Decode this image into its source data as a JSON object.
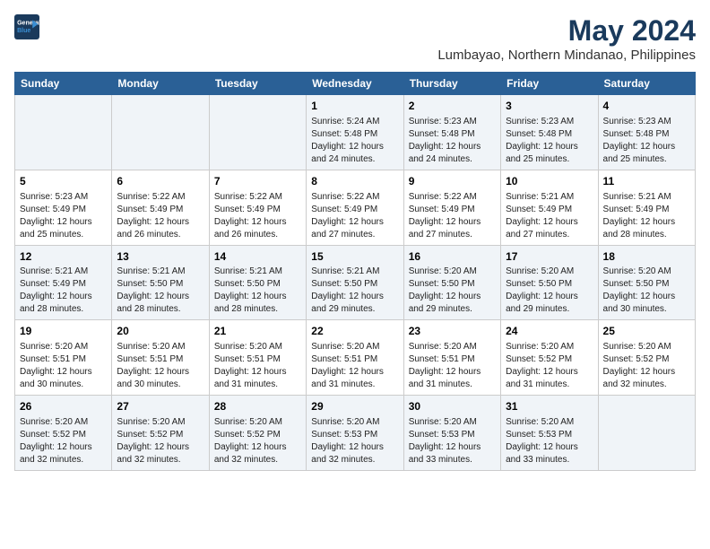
{
  "logo": {
    "line1": "General",
    "line2": "Blue"
  },
  "title": "May 2024",
  "subtitle": "Lumbayao, Northern Mindanao, Philippines",
  "weekdays": [
    "Sunday",
    "Monday",
    "Tuesday",
    "Wednesday",
    "Thursday",
    "Friday",
    "Saturday"
  ],
  "weeks": [
    [
      {
        "day": "",
        "info": ""
      },
      {
        "day": "",
        "info": ""
      },
      {
        "day": "",
        "info": ""
      },
      {
        "day": "1",
        "info": "Sunrise: 5:24 AM\nSunset: 5:48 PM\nDaylight: 12 hours\nand 24 minutes."
      },
      {
        "day": "2",
        "info": "Sunrise: 5:23 AM\nSunset: 5:48 PM\nDaylight: 12 hours\nand 24 minutes."
      },
      {
        "day": "3",
        "info": "Sunrise: 5:23 AM\nSunset: 5:48 PM\nDaylight: 12 hours\nand 25 minutes."
      },
      {
        "day": "4",
        "info": "Sunrise: 5:23 AM\nSunset: 5:48 PM\nDaylight: 12 hours\nand 25 minutes."
      }
    ],
    [
      {
        "day": "5",
        "info": "Sunrise: 5:23 AM\nSunset: 5:49 PM\nDaylight: 12 hours\nand 25 minutes."
      },
      {
        "day": "6",
        "info": "Sunrise: 5:22 AM\nSunset: 5:49 PM\nDaylight: 12 hours\nand 26 minutes."
      },
      {
        "day": "7",
        "info": "Sunrise: 5:22 AM\nSunset: 5:49 PM\nDaylight: 12 hours\nand 26 minutes."
      },
      {
        "day": "8",
        "info": "Sunrise: 5:22 AM\nSunset: 5:49 PM\nDaylight: 12 hours\nand 27 minutes."
      },
      {
        "day": "9",
        "info": "Sunrise: 5:22 AM\nSunset: 5:49 PM\nDaylight: 12 hours\nand 27 minutes."
      },
      {
        "day": "10",
        "info": "Sunrise: 5:21 AM\nSunset: 5:49 PM\nDaylight: 12 hours\nand 27 minutes."
      },
      {
        "day": "11",
        "info": "Sunrise: 5:21 AM\nSunset: 5:49 PM\nDaylight: 12 hours\nand 28 minutes."
      }
    ],
    [
      {
        "day": "12",
        "info": "Sunrise: 5:21 AM\nSunset: 5:49 PM\nDaylight: 12 hours\nand 28 minutes."
      },
      {
        "day": "13",
        "info": "Sunrise: 5:21 AM\nSunset: 5:50 PM\nDaylight: 12 hours\nand 28 minutes."
      },
      {
        "day": "14",
        "info": "Sunrise: 5:21 AM\nSunset: 5:50 PM\nDaylight: 12 hours\nand 28 minutes."
      },
      {
        "day": "15",
        "info": "Sunrise: 5:21 AM\nSunset: 5:50 PM\nDaylight: 12 hours\nand 29 minutes."
      },
      {
        "day": "16",
        "info": "Sunrise: 5:20 AM\nSunset: 5:50 PM\nDaylight: 12 hours\nand 29 minutes."
      },
      {
        "day": "17",
        "info": "Sunrise: 5:20 AM\nSunset: 5:50 PM\nDaylight: 12 hours\nand 29 minutes."
      },
      {
        "day": "18",
        "info": "Sunrise: 5:20 AM\nSunset: 5:50 PM\nDaylight: 12 hours\nand 30 minutes."
      }
    ],
    [
      {
        "day": "19",
        "info": "Sunrise: 5:20 AM\nSunset: 5:51 PM\nDaylight: 12 hours\nand 30 minutes."
      },
      {
        "day": "20",
        "info": "Sunrise: 5:20 AM\nSunset: 5:51 PM\nDaylight: 12 hours\nand 30 minutes."
      },
      {
        "day": "21",
        "info": "Sunrise: 5:20 AM\nSunset: 5:51 PM\nDaylight: 12 hours\nand 31 minutes."
      },
      {
        "day": "22",
        "info": "Sunrise: 5:20 AM\nSunset: 5:51 PM\nDaylight: 12 hours\nand 31 minutes."
      },
      {
        "day": "23",
        "info": "Sunrise: 5:20 AM\nSunset: 5:51 PM\nDaylight: 12 hours\nand 31 minutes."
      },
      {
        "day": "24",
        "info": "Sunrise: 5:20 AM\nSunset: 5:52 PM\nDaylight: 12 hours\nand 31 minutes."
      },
      {
        "day": "25",
        "info": "Sunrise: 5:20 AM\nSunset: 5:52 PM\nDaylight: 12 hours\nand 32 minutes."
      }
    ],
    [
      {
        "day": "26",
        "info": "Sunrise: 5:20 AM\nSunset: 5:52 PM\nDaylight: 12 hours\nand 32 minutes."
      },
      {
        "day": "27",
        "info": "Sunrise: 5:20 AM\nSunset: 5:52 PM\nDaylight: 12 hours\nand 32 minutes."
      },
      {
        "day": "28",
        "info": "Sunrise: 5:20 AM\nSunset: 5:52 PM\nDaylight: 12 hours\nand 32 minutes."
      },
      {
        "day": "29",
        "info": "Sunrise: 5:20 AM\nSunset: 5:53 PM\nDaylight: 12 hours\nand 32 minutes."
      },
      {
        "day": "30",
        "info": "Sunrise: 5:20 AM\nSunset: 5:53 PM\nDaylight: 12 hours\nand 33 minutes."
      },
      {
        "day": "31",
        "info": "Sunrise: 5:20 AM\nSunset: 5:53 PM\nDaylight: 12 hours\nand 33 minutes."
      },
      {
        "day": "",
        "info": ""
      }
    ]
  ]
}
